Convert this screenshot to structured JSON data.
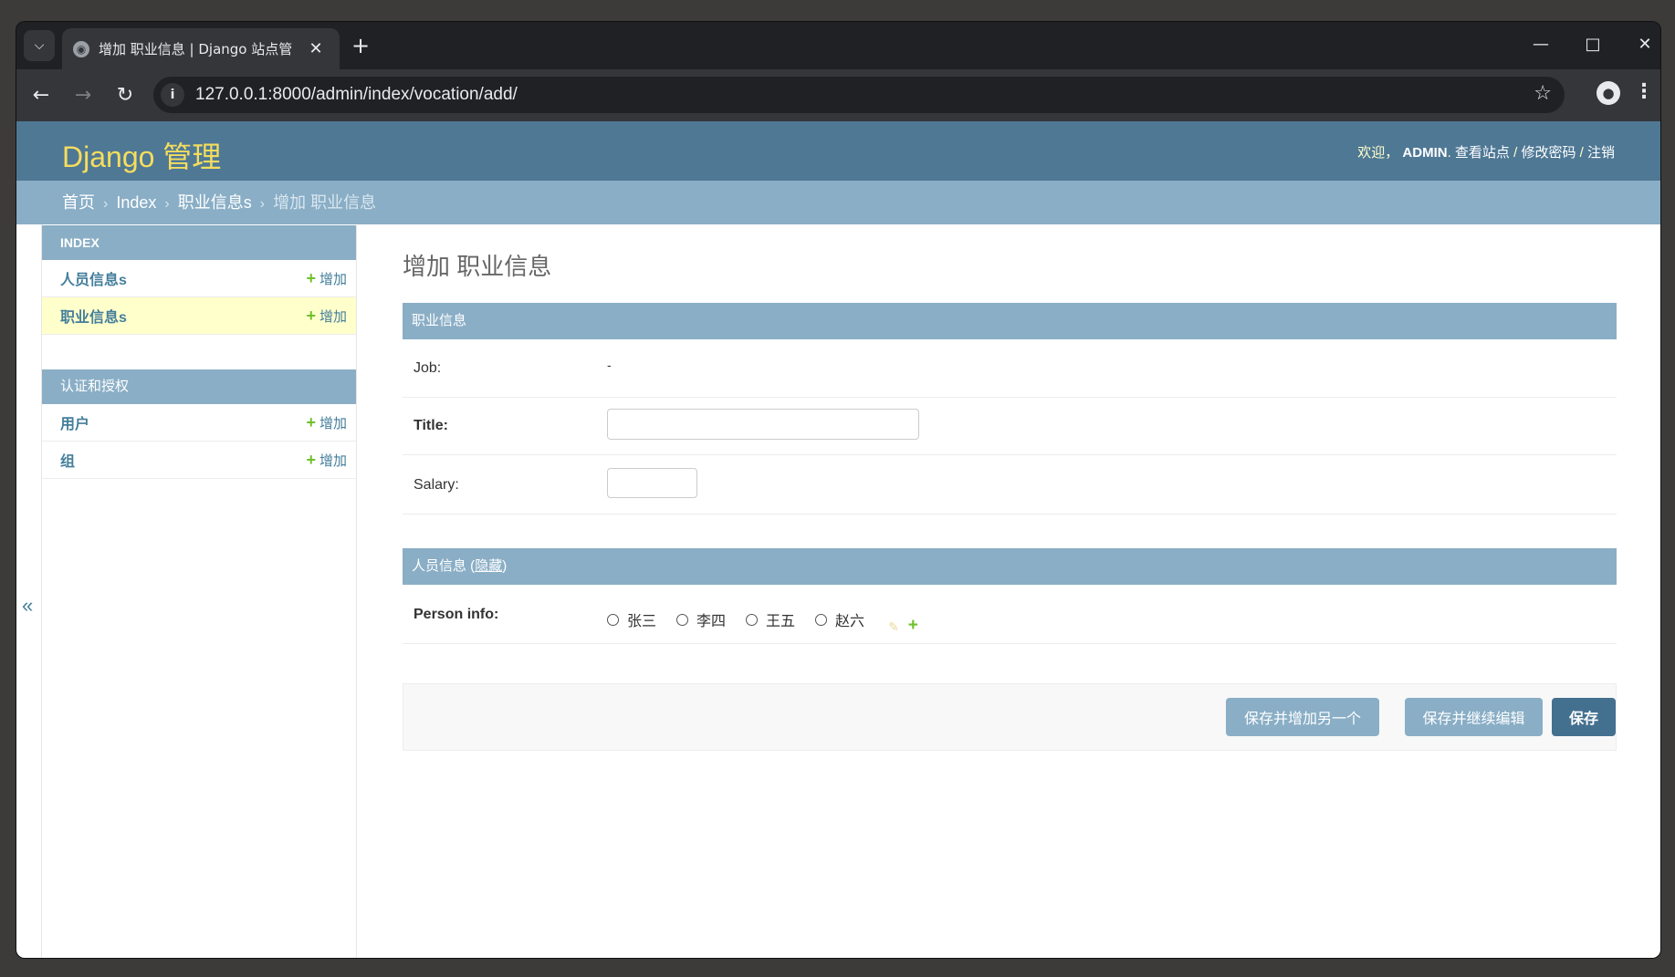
{
  "browser": {
    "tab_title": "增加 职业信息 | Django 站点管",
    "url": "127.0.0.1:8000/admin/index/vocation/add/"
  },
  "header": {
    "branding": "Django 管理",
    "welcome": "欢迎，",
    "username": "ADMIN",
    "view_site": "查看站点",
    "change_password": "修改密码",
    "logout": "注销",
    "separator": "/"
  },
  "breadcrumbs": {
    "home": "首页",
    "app": "Index",
    "model": "职业信息s",
    "current": "增加 职业信息",
    "sep": "›"
  },
  "sidebar": {
    "toggle": "«",
    "modules": [
      {
        "caption": "INDEX",
        "models": [
          {
            "name": "人员信息s",
            "add": "增加"
          },
          {
            "name": "职业信息s",
            "add": "增加",
            "current": true
          }
        ]
      },
      {
        "caption": "认证和授权",
        "models": [
          {
            "name": "用户",
            "add": "增加"
          },
          {
            "name": "组",
            "add": "增加"
          }
        ]
      }
    ]
  },
  "content": {
    "title": "增加 职业信息",
    "fieldset1": {
      "caption": "职业信息",
      "job_label": "Job:",
      "job_value": "-",
      "title_label": "Title:",
      "title_value": "",
      "salary_label": "Salary:",
      "salary_value": ""
    },
    "fieldset2": {
      "caption": "人员信息",
      "toggle": "隐藏",
      "person_label": "Person info:",
      "options": [
        "张三",
        "李四",
        "王五",
        "赵六"
      ]
    },
    "submit": {
      "save_add_another": "保存并增加另一个",
      "save_continue": "保存并继续编辑",
      "save": "保存"
    }
  },
  "colors": {
    "header_bg": "#4f7895",
    "branding": "#f5dd5d",
    "breadcrumb_bg": "#89aec6",
    "caption_bg": "#8aaec6",
    "link": "#447e9b",
    "add_green": "#70bf2b",
    "current_row": "#ffffcc",
    "primary_button": "#447090"
  }
}
